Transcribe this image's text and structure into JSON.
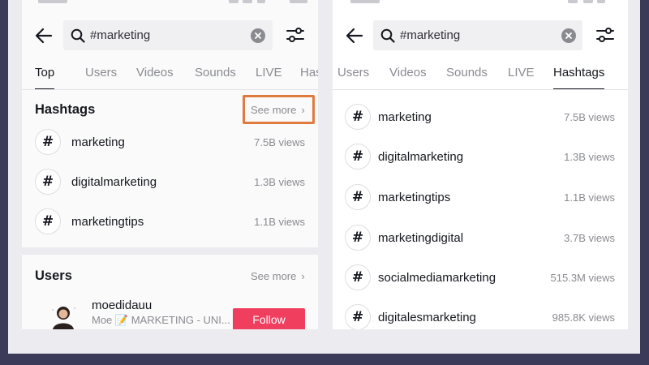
{
  "search": {
    "query": "#marketing"
  },
  "left": {
    "tabs": [
      "Top",
      "Users",
      "Videos",
      "Sounds",
      "LIVE",
      "Hashtags"
    ],
    "active_tab": "Top",
    "hashtags_title": "Hashtags",
    "see_more": "See more",
    "hashtags": [
      {
        "name": "marketing",
        "views": "7.5B views"
      },
      {
        "name": "digitalmarketing",
        "views": "1.3B views"
      },
      {
        "name": "marketingtips",
        "views": "1.1B views"
      }
    ],
    "users_title": "Users",
    "user": {
      "name": "moedidauu",
      "desc": "Moe 📝 MARKETING - UNI...",
      "follow": "Follow"
    }
  },
  "right": {
    "tabs": [
      "Users",
      "Videos",
      "Sounds",
      "LIVE",
      "Hashtags"
    ],
    "active_tab": "Hashtags",
    "hashtags": [
      {
        "name": "marketing",
        "views": "7.5B views"
      },
      {
        "name": "digitalmarketing",
        "views": "1.3B views"
      },
      {
        "name": "marketingtips",
        "views": "1.1B views"
      },
      {
        "name": "marketingdigital",
        "views": "3.7B views"
      },
      {
        "name": "socialmediamarketing",
        "views": "515.3M views"
      },
      {
        "name": "digitalesmarketing",
        "views": "985.8K views"
      }
    ]
  },
  "colors": {
    "background": "#3b3a59",
    "highlight": "#e07a3e",
    "follow": "#f03e5f",
    "text": "#16181f",
    "muted": "#8a8b91"
  },
  "icons": {
    "back": "back-arrow-icon",
    "search": "search-icon",
    "clear": "clear-icon",
    "filter": "filter-icon",
    "hashtag": "hashtag-icon"
  }
}
